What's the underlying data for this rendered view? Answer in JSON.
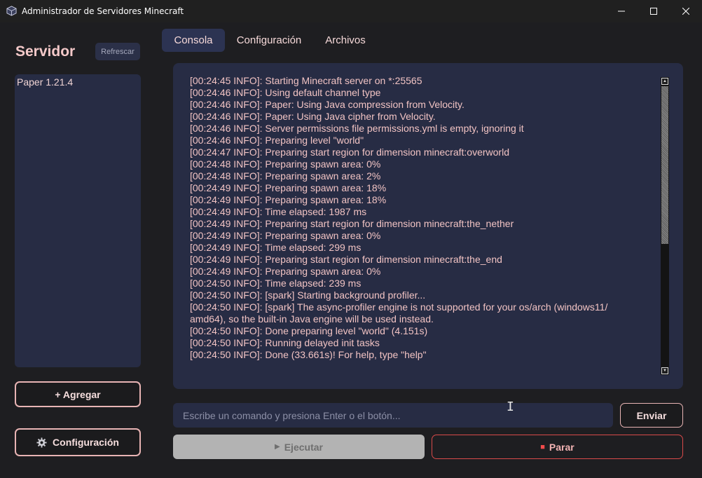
{
  "window": {
    "title": "Administrador de Servidores Minecraft",
    "minimize": "—",
    "maximize": "☐",
    "close": "✕"
  },
  "sidebar": {
    "title": "Servidor",
    "refresh_label": "Refrescar",
    "servers": [
      "Paper 1.21.4"
    ],
    "add_label": "+ Agregar",
    "config_label": "Configuración",
    "config_icon": "gear-icon"
  },
  "tabs": [
    {
      "label": "Consola",
      "active": true
    },
    {
      "label": "Configuración",
      "active": false
    },
    {
      "label": "Archivos",
      "active": false
    }
  ],
  "console": {
    "lines": [
      "[00:24:45 INFO]: Starting Minecraft server on *:25565",
      "[00:24:46 INFO]: Using default channel type",
      "[00:24:46 INFO]: Paper: Using Java compression from Velocity.",
      "[00:24:46 INFO]: Paper: Using Java cipher from Velocity.",
      "[00:24:46 INFO]: Server permissions file permissions.yml is empty, ignoring it",
      "[00:24:46 INFO]: Preparing level \"world\"",
      "[00:24:47 INFO]: Preparing start region for dimension minecraft:overworld",
      "[00:24:48 INFO]: Preparing spawn area: 0%",
      "[00:24:48 INFO]: Preparing spawn area: 2%",
      "[00:24:49 INFO]: Preparing spawn area: 18%",
      "[00:24:49 INFO]: Preparing spawn area: 18%",
      "[00:24:49 INFO]: Time elapsed: 1987 ms",
      "[00:24:49 INFO]: Preparing start region for dimension minecraft:the_nether",
      "[00:24:49 INFO]: Preparing spawn area: 0%",
      "[00:24:49 INFO]: Time elapsed: 299 ms",
      "[00:24:49 INFO]: Preparing start region for dimension minecraft:the_end",
      "[00:24:49 INFO]: Preparing spawn area: 0%",
      "[00:24:50 INFO]: Time elapsed: 239 ms",
      "[00:24:50 INFO]: [spark] Starting background profiler...",
      "[00:24:50 INFO]: [spark] The async-profiler engine is not supported for your os/arch (windows11/\namd64), so the built-in Java engine will be used instead.",
      "[00:24:50 INFO]: Done preparing level \"world\" (4.151s)",
      "[00:24:50 INFO]: Running delayed init tasks",
      "[00:24:50 INFO]: Done (33.661s)! For help, type \"help\""
    ]
  },
  "command": {
    "placeholder": "Escribe un comando y presiona Enter o el botón...",
    "value": "",
    "send_label": "Enviar"
  },
  "controls": {
    "run_label": "Ejecutar",
    "run_icon": "play-icon",
    "run_enabled": false,
    "stop_label": "Parar",
    "stop_icon": "stop-icon"
  }
}
